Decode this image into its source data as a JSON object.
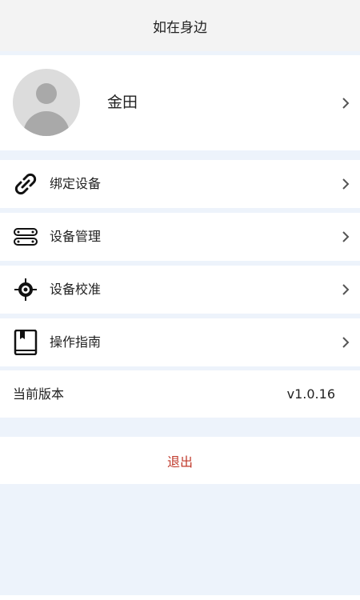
{
  "header": {
    "title": "如在身边"
  },
  "profile": {
    "name": "金田"
  },
  "menu": [
    {
      "label": "绑定设备",
      "icon": "link-icon"
    },
    {
      "label": "设备管理",
      "icon": "device-list-icon"
    },
    {
      "label": "设备校准",
      "icon": "target-icon"
    },
    {
      "label": "操作指南",
      "icon": "book-icon"
    }
  ],
  "version": {
    "label": "当前版本",
    "value": "v1.0.16"
  },
  "logout": {
    "label": "退出",
    "color": "#c0392b"
  },
  "colors": {
    "background": "#edf3fb",
    "header": "#f3f3f3",
    "accent": "#c0392b"
  }
}
